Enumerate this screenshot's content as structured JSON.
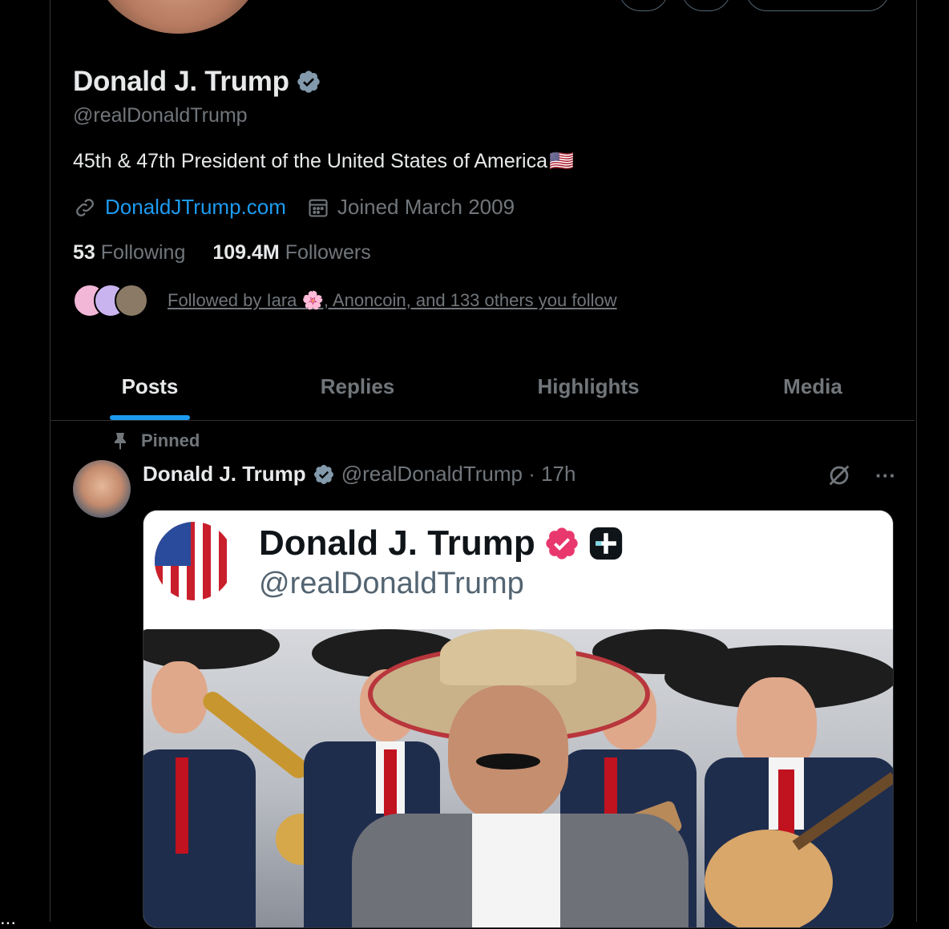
{
  "profile": {
    "name": "Donald J. Trump",
    "handle": "@realDonaldTrump",
    "bio": "45th & 47th President of the United States of America",
    "bio_flag": "🇺🇸",
    "website": "DonaldJTrump.com",
    "joined": "Joined March 2009",
    "following_count": "53",
    "following_label": "Following",
    "followers_count": "109.4M",
    "followers_label": "Followers",
    "followed_by": "Followed by Iara 🌸, Anoncoin, and 133 others you follow"
  },
  "tabs": [
    {
      "label": "Posts",
      "active": true
    },
    {
      "label": "Replies",
      "active": false
    },
    {
      "label": "Highlights",
      "active": false
    },
    {
      "label": "Media",
      "active": false
    }
  ],
  "post": {
    "pinned_label": "Pinned",
    "author": "Donald J. Trump",
    "handle_time": "@realDonaldTrump · 17h",
    "more_label": "···",
    "embedded_card": {
      "name": "Donald J. Trump",
      "handle": "@realDonaldTrump"
    }
  },
  "colors": {
    "background": "#000000",
    "accent": "#1d9bf0",
    "muted": "#71767b",
    "verified_gray": "#829aab",
    "verified_pink": "#e8386d"
  },
  "icons": [
    "verified-badge-icon",
    "link-icon",
    "calendar-icon",
    "pin-icon",
    "grok-icon",
    "more-icon",
    "plus-icon"
  ],
  "misc": {
    "edge_dots": "..."
  }
}
